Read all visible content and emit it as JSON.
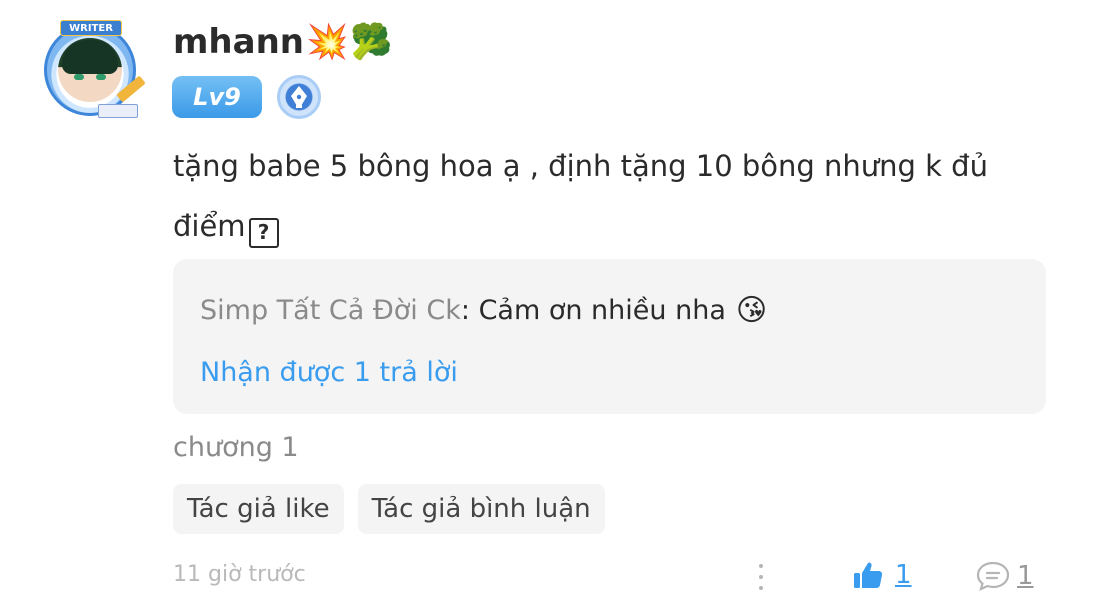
{
  "user": {
    "avatar_banner": "WRITER",
    "name": "mhann",
    "name_emojis": [
      "💥",
      "🥦"
    ],
    "level": "Lv9",
    "level_color": "#3b9ae8",
    "badge_icon": "pen-nib-icon"
  },
  "comment": {
    "text_line1": "tặng babe 5 bông hoa ạ , định tặng 10 bông nhưng k đủ",
    "text_line2": "điểm",
    "unknown_glyph": "?"
  },
  "reply_preview": {
    "author": "Simp Tất Cả Đời Ck",
    "separator": ": ",
    "text": "Cảm ơn nhiều nha",
    "emoji": "😘",
    "count_label": "Nhận được 1 trả lời",
    "link_color": "#3a9cee"
  },
  "chapter": "chương 1",
  "tags": [
    "Tác giả like",
    "Tác giả bình luận"
  ],
  "footer": {
    "time": "11 giờ trước",
    "like_count": "1",
    "reply_count": "1"
  }
}
